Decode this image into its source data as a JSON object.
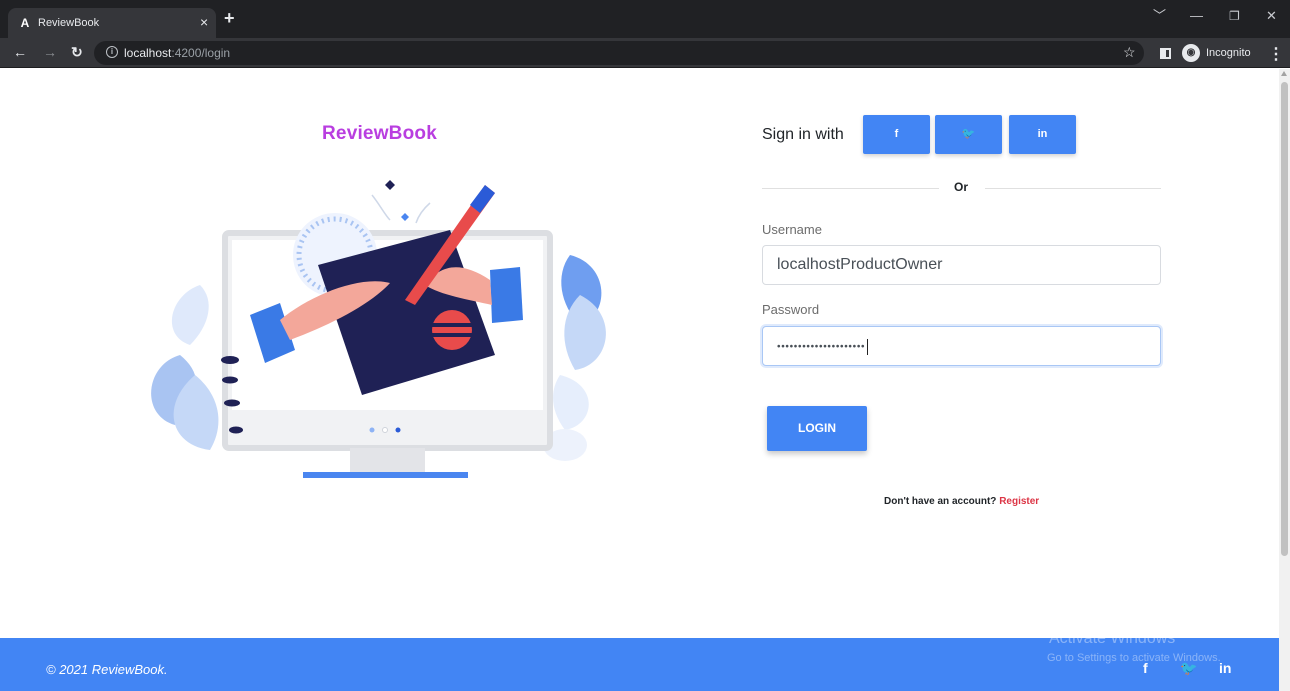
{
  "browser": {
    "tab_title": "ReviewBook",
    "tab_favicon": "A",
    "close_glyph": "×",
    "new_tab_glyph": "+",
    "url_host": "localhost",
    "url_path": ":4200/login",
    "profile_label": "Incognito",
    "icons": [
      "angular-favicon-icon",
      "close-icon",
      "plus-icon",
      "back-arrow-icon",
      "forward-arrow-icon",
      "reload-icon",
      "info-icon",
      "star-icon",
      "side-panel-icon",
      "incognito-icon",
      "kebab-menu-icon",
      "chevron-down-icon",
      "minimize-icon",
      "restore-icon",
      "close-window-icon"
    ]
  },
  "app": {
    "brand": "ReviewBook",
    "brand_color": "#b93ee0",
    "accent_color": "#4285f4",
    "link_color": "#dc3545"
  },
  "login": {
    "signin_with": "Sign in with",
    "social": [
      {
        "name": "facebook",
        "glyph": "f"
      },
      {
        "name": "twitter",
        "glyph": "🐦"
      },
      {
        "name": "linkedin",
        "glyph": "in"
      }
    ],
    "divider_text": "Or",
    "username_label": "Username",
    "username_value": "localhostProductOwner",
    "password_label": "Password",
    "password_mask": "•••••••••••••••••••••",
    "login_button": "LOGIN",
    "no_account_text": "Don't have an account?",
    "register_link": "Register"
  },
  "footer": {
    "copyright": "© 2021 ReviewBook.",
    "social": [
      {
        "name": "facebook",
        "glyph": "f"
      },
      {
        "name": "twitter",
        "glyph": "🐦"
      },
      {
        "name": "linkedin",
        "glyph": "in"
      }
    ]
  },
  "watermark": {
    "title": "Activate Windows",
    "subtitle": "Go to Settings to activate Windows."
  }
}
